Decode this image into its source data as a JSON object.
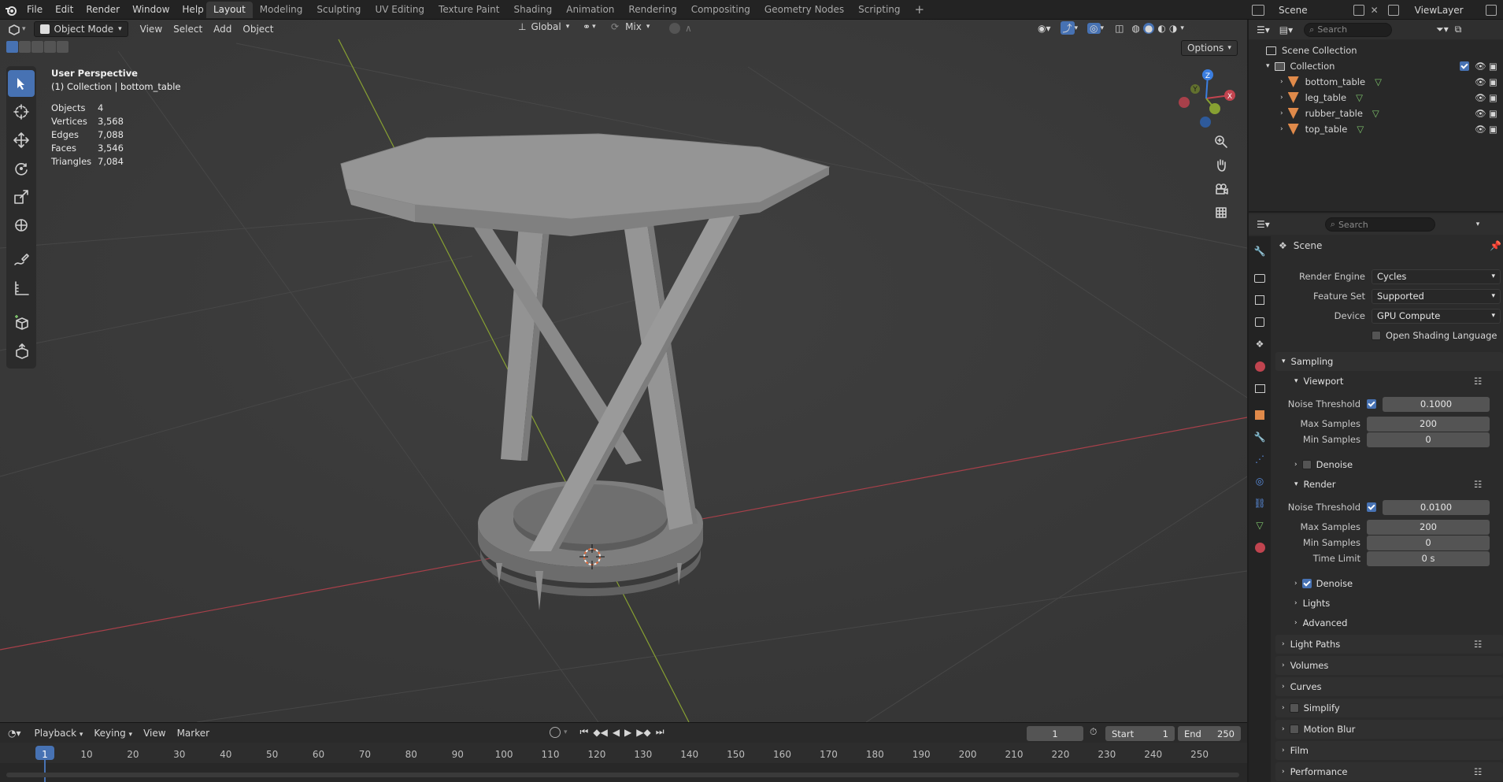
{
  "menubar": {
    "items": [
      "File",
      "Edit",
      "Render",
      "Window",
      "Help"
    ],
    "workspaces": [
      "Layout",
      "Modeling",
      "Sculpting",
      "UV Editing",
      "Texture Paint",
      "Shading",
      "Animation",
      "Rendering",
      "Compositing",
      "Geometry Nodes",
      "Scripting"
    ],
    "active_workspace": "Layout",
    "add_tab_icon": "plus-icon",
    "scene_name": "Scene",
    "view_layer": "ViewLayer"
  },
  "viewport_header": {
    "mode": "Object Mode",
    "menus": [
      "View",
      "Select",
      "Add",
      "Object"
    ],
    "transform_orientation": "Global",
    "snap_mode": "Mix",
    "options_label": "Options"
  },
  "viewport_info": {
    "perspective": "User Perspective",
    "context": "(1) Collection | bottom_table",
    "stats": [
      {
        "label": "Objects",
        "value": "4"
      },
      {
        "label": "Vertices",
        "value": "3,568"
      },
      {
        "label": "Edges",
        "value": "7,088"
      },
      {
        "label": "Faces",
        "value": "3,546"
      },
      {
        "label": "Triangles",
        "value": "7,084"
      }
    ]
  },
  "gizmo": {
    "x": "X",
    "y": "Y",
    "z": "Z"
  },
  "outliner": {
    "search_placeholder": "Search",
    "root": "Scene Collection",
    "collection": "Collection",
    "objects": [
      "bottom_table",
      "leg_table",
      "rubber_table",
      "top_table"
    ]
  },
  "properties": {
    "search_placeholder": "Search",
    "context": "Scene",
    "render_engine_label": "Render Engine",
    "render_engine": "Cycles",
    "feature_set_label": "Feature Set",
    "feature_set": "Supported",
    "device_label": "Device",
    "device": "GPU Compute",
    "osl_label": "Open Shading Language",
    "sampling": "Sampling",
    "viewport": "Viewport",
    "noise_threshold_label": "Noise Threshold",
    "viewport_noise_threshold": "0.1000",
    "max_samples_label": "Max Samples",
    "viewport_max_samples": "200",
    "min_samples_label": "Min Samples",
    "viewport_min_samples": "0",
    "denoise_label": "Denoise",
    "render": "Render",
    "render_noise_threshold": "0.0100",
    "render_max_samples": "200",
    "render_min_samples": "0",
    "time_limit_label": "Time Limit",
    "time_limit": "0 s",
    "lights": "Lights",
    "advanced": "Advanced",
    "light_paths": "Light Paths",
    "volumes": "Volumes",
    "curves": "Curves",
    "simplify": "Simplify",
    "motion_blur": "Motion Blur",
    "film": "Film",
    "performance": "Performance"
  },
  "timeline": {
    "menus": [
      "Playback",
      "Keying",
      "View",
      "Marker"
    ],
    "current_frame": "1",
    "start_label": "Start",
    "start": "1",
    "end_label": "End",
    "end": "250",
    "ruler": [
      "1",
      "10",
      "20",
      "30",
      "40",
      "50",
      "60",
      "70",
      "80",
      "90",
      "100",
      "110",
      "120",
      "130",
      "140",
      "150",
      "160",
      "170",
      "180",
      "190",
      "200",
      "210",
      "220",
      "230",
      "240",
      "250"
    ]
  },
  "colors": {
    "accent": "#4772b3",
    "viewport_bg": "#3c3c3c",
    "x_axis": "#b8434f",
    "y_axis": "#8aa337",
    "z_axis": "#3b7ee0"
  }
}
